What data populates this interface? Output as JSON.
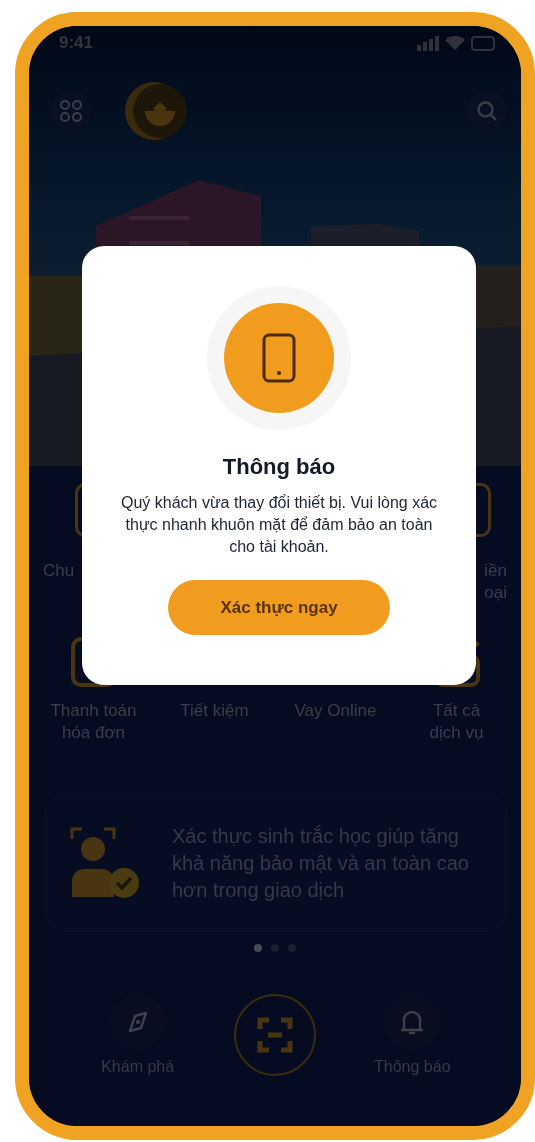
{
  "status_bar": {
    "time": "9:41"
  },
  "services": [
    {
      "items": [
        {
          "lines": [
            "Chu"
          ],
          "kind": "left-edge"
        },
        {
          "lines": [
            "iền",
            "oại"
          ],
          "kind": "right-edge"
        }
      ]
    },
    {
      "items": [
        {
          "lines": [
            "Thanh toán",
            "hóa đơn"
          ],
          "kind": "bill"
        },
        {
          "lines": [
            "Tiết kiệm"
          ],
          "kind": "none"
        },
        {
          "lines": [
            "Vay Online"
          ],
          "kind": "none"
        },
        {
          "lines": [
            "Tất cả",
            "dịch vụ"
          ],
          "kind": "all"
        }
      ]
    }
  ],
  "banner": {
    "text": "Xác thực sinh trắc học giúp tăng khả năng bảo mật và an toàn cao hơn trong giao dịch"
  },
  "banner_dots": [
    {
      "selected": true
    },
    {
      "selected": false
    },
    {
      "selected": false
    }
  ],
  "bottom_nav": [
    {
      "kind": "compass",
      "label": "Khám phá"
    },
    {
      "kind": "scan"
    },
    {
      "kind": "bell",
      "label": "Thông báo"
    }
  ],
  "dialog": {
    "title": "Thông báo",
    "message": "Quý khách vừa thay đổi thiết bị. Vui lòng xác thực nhanh khuôn mặt để đảm bảo an toàn cho tài khoản.",
    "button": "Xác thực ngay"
  }
}
